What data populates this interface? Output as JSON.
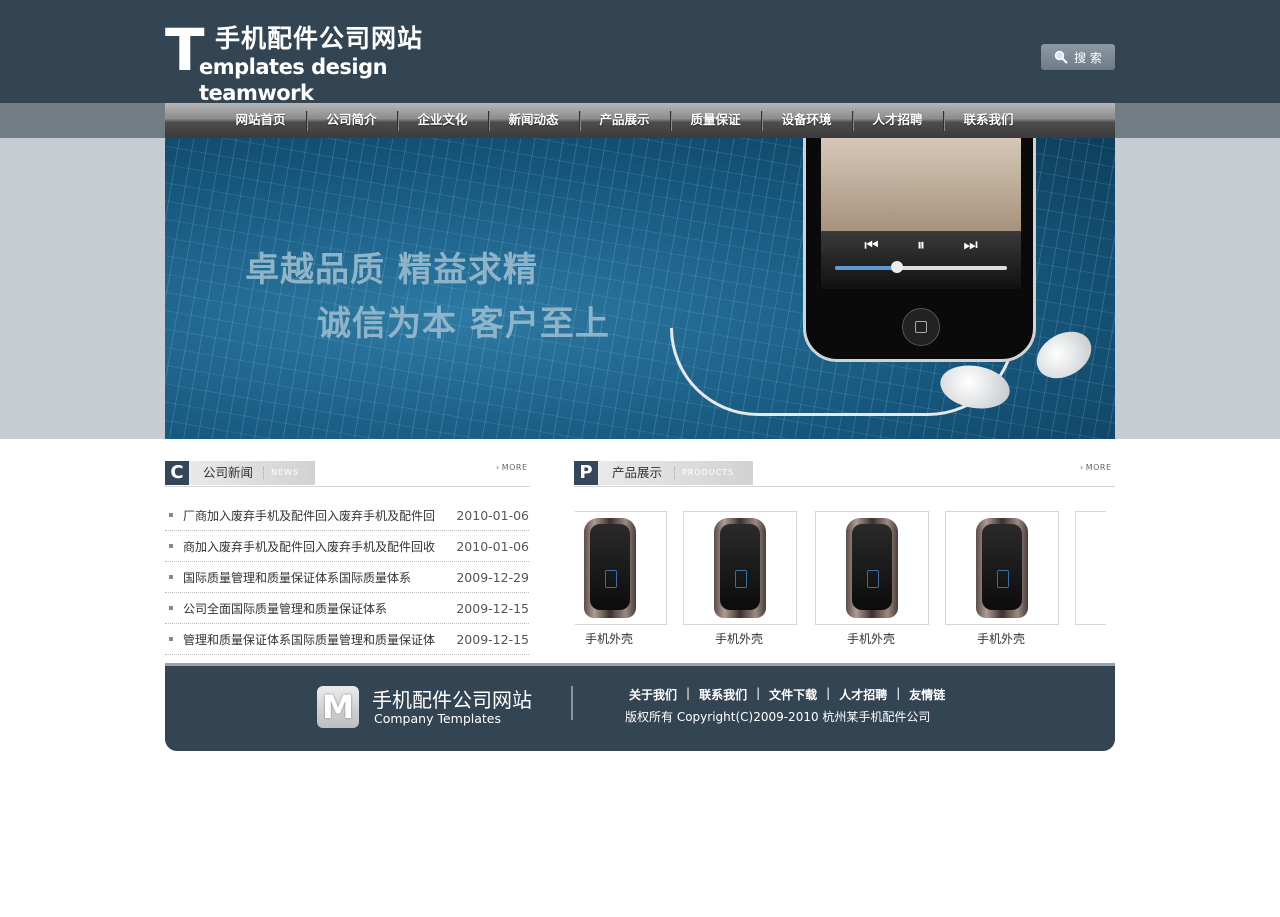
{
  "header": {
    "logo_letter": "T",
    "logo_title": "手机配件公司网站",
    "logo_subtitle": "emplates design teamwork",
    "search_label": "搜 索"
  },
  "nav": {
    "items": [
      "网站首页",
      "公司简介",
      "企业文化",
      "新闻动态",
      "产品展示",
      "质量保证",
      "设备环境",
      "人才招聘",
      "联系我们"
    ]
  },
  "banner": {
    "slogan_line1": "卓越品质 精益求精",
    "slogan_line2": "诚信为本 客户至上"
  },
  "news": {
    "badge": "C",
    "title": "公司新闻",
    "en": "NEWS",
    "more": "MORE",
    "items": [
      {
        "title": "厂商加入废弃手机及配件回入废弃手机及配件回",
        "date": "2010-01-06"
      },
      {
        "title": "商加入废弃手机及配件回入废弃手机及配件回收",
        "date": "2010-01-06"
      },
      {
        "title": "国际质量管理和质量保证体系国际质量体系",
        "date": "2009-12-29"
      },
      {
        "title": "公司全面国际质量管理和质量保证体系",
        "date": "2009-12-15"
      },
      {
        "title": "管理和质量保证体系国际质量管理和质量保证体",
        "date": "2009-12-15"
      }
    ]
  },
  "products": {
    "badge": "P",
    "title": "产品展示",
    "en": "PRODUCTS",
    "more": "MORE",
    "items": [
      {
        "name": "手机外壳"
      },
      {
        "name": "手机外壳"
      },
      {
        "name": "手机外壳"
      },
      {
        "name": "手机外壳"
      }
    ]
  },
  "footer": {
    "logo_letter": "M",
    "name": "手机配件公司网站",
    "en": "Company Templates",
    "links": [
      "关于我们",
      "联系我们",
      "文件下载",
      "人才招聘",
      "友情链"
    ],
    "copyright": "版权所有 Copyright(C)2009-2010 杭州某手机配件公司"
  },
  "colors": {
    "header_bg": "#334453",
    "accent": "#34465a"
  }
}
